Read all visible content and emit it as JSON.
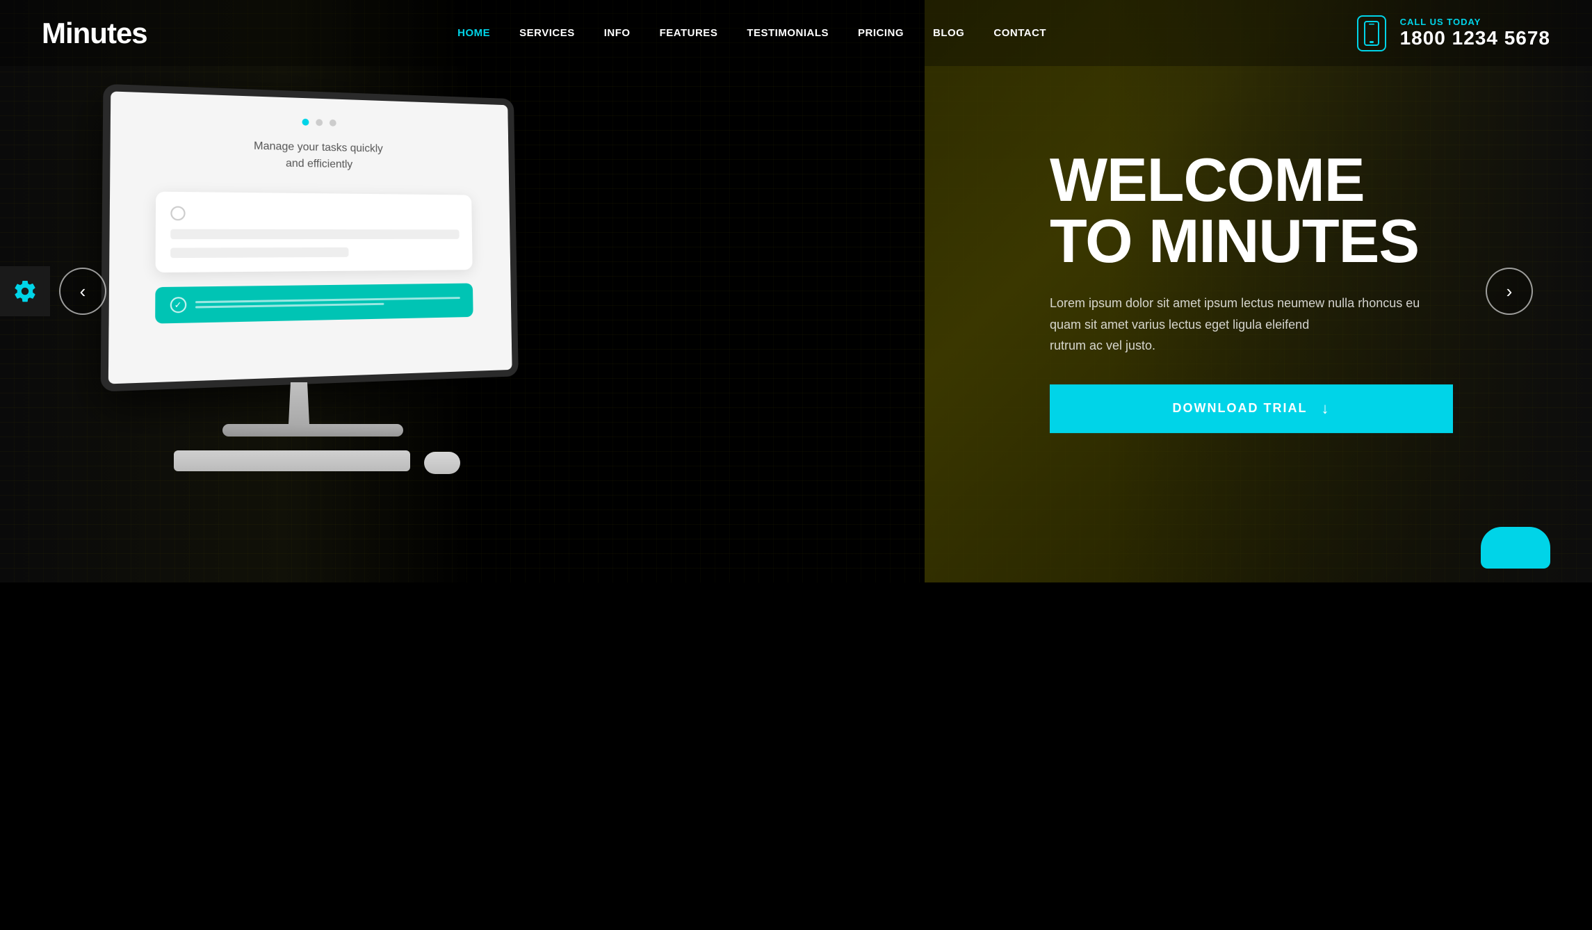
{
  "brand": {
    "logo": "Minutes"
  },
  "navbar": {
    "links": [
      {
        "label": "HOME",
        "active": true
      },
      {
        "label": "SERVICES",
        "active": false
      },
      {
        "label": "INFO",
        "active": false
      },
      {
        "label": "FEATURES",
        "active": false
      },
      {
        "label": "TESTIMONIALS",
        "active": false
      },
      {
        "label": "PRICING",
        "active": false
      },
      {
        "label": "BLOG",
        "active": false
      },
      {
        "label": "CONTACT",
        "active": false
      }
    ],
    "call_label": "CALL US TODAY",
    "phone": "1800 1234 5678"
  },
  "hero": {
    "title_line1": "WELCOME",
    "title_line2": "TO MINUTES",
    "description": "Lorem ipsum dolor sit amet ipsum lectus neumew nulla rhoncus eu quam sit amet varius lectus eget ligula eleifend\nrutrum ac vel justo.",
    "cta_label": "DOWNLOAD TRIAL"
  },
  "monitor": {
    "screen_text": "Manage your tasks quickly\nand efficiently"
  },
  "slider": {
    "prev_label": "‹",
    "next_label": "›"
  }
}
